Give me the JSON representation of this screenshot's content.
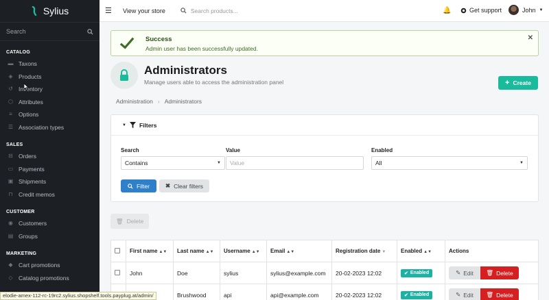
{
  "brand": {
    "name": "Sylius",
    "color": "#1abb9c"
  },
  "sidebar": {
    "search_placeholder": "Search",
    "sections": [
      {
        "title": "CATALOG",
        "items": [
          {
            "label": "Taxons",
            "icon": "folder-icon"
          },
          {
            "label": "Products",
            "icon": "cube-icon"
          },
          {
            "label": "Inventory",
            "icon": "history-icon"
          },
          {
            "label": "Attributes",
            "icon": "cubes-icon"
          },
          {
            "label": "Options",
            "icon": "sliders-icon"
          },
          {
            "label": "Association types",
            "icon": "list-icon"
          }
        ]
      },
      {
        "title": "SALES",
        "items": [
          {
            "label": "Orders",
            "icon": "cart-icon"
          },
          {
            "label": "Payments",
            "icon": "payment-icon"
          },
          {
            "label": "Shipments",
            "icon": "truck-icon"
          },
          {
            "label": "Credit memos",
            "icon": "inbox-icon"
          }
        ]
      },
      {
        "title": "CUSTOMER",
        "items": [
          {
            "label": "Customers",
            "icon": "users-icon"
          },
          {
            "label": "Groups",
            "icon": "archive-icon"
          }
        ]
      },
      {
        "title": "MARKETING",
        "items": [
          {
            "label": "Cart promotions",
            "icon": "tag-icon"
          },
          {
            "label": "Catalog promotions",
            "icon": "tags-icon"
          }
        ]
      }
    ]
  },
  "topbar": {
    "view_store": "View your store",
    "search_placeholder": "Search products...",
    "support": "Get support",
    "user": "John"
  },
  "alert": {
    "title": "Success",
    "message": "Admin user has been successfully updated."
  },
  "header": {
    "title": "Administrators",
    "subtitle": "Manage users able to access the administration panel",
    "create": "Create"
  },
  "breadcrumb": [
    "Administration",
    "Administrators"
  ],
  "filters": {
    "title": "Filters",
    "search_label": "Search",
    "search_value": "Contains",
    "value_label": "Value",
    "value_placeholder": "Value",
    "enabled_label": "Enabled",
    "enabled_value": "All",
    "filter_button": "Filter",
    "clear_button": "Clear filters"
  },
  "bulk_delete": "Delete",
  "table": {
    "columns": [
      "First name",
      "Last name",
      "Username",
      "Email",
      "Registration date",
      "Enabled",
      "Actions"
    ],
    "rows": [
      {
        "first": "John",
        "last": "Doe",
        "username": "sylius",
        "email": "sylius@example.com",
        "date": "20-02-2023 12:02",
        "enabled": "Enabled",
        "edit": "Edit",
        "delete": "Delete"
      },
      {
        "first": "",
        "last": "Brushwood",
        "username": "api",
        "email": "api@example.com",
        "date": "20-02-2023 12:02",
        "enabled": "Enabled",
        "edit": "Edit",
        "delete": "Delete"
      }
    ]
  },
  "statusbar": "elodie-amex-112-rc-19rc2.sylius.shopshelf.tools.payplug.at/admin/"
}
